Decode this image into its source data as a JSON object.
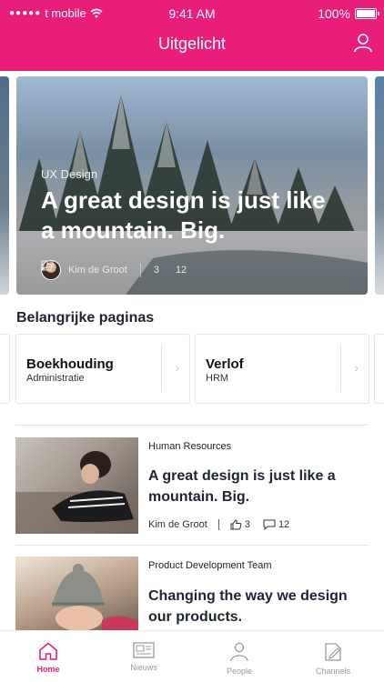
{
  "status_bar": {
    "carrier": "t mobile",
    "time": "9:41 AM",
    "battery": "100%"
  },
  "header": {
    "title": "Uitgelicht"
  },
  "hero": {
    "category": "UX Design",
    "title": "A great design is just like a mountain. Big.",
    "author": "Kim de Groot",
    "likes": "3",
    "comments": "12"
  },
  "important_pages": {
    "heading": "Belangrijke paginas",
    "items": [
      {
        "title": "Boekhouding",
        "subtitle": "Administratie"
      },
      {
        "title": "Verlof",
        "subtitle": "HRM"
      }
    ]
  },
  "news": [
    {
      "source": "Human Resources",
      "title": "A great design is just like a mountain. Big.",
      "author": "Kim de Groot",
      "likes": "3",
      "comments": "12"
    },
    {
      "source": "Product Development Team",
      "title": "Changing the way we design our products."
    }
  ],
  "tabs": [
    {
      "label": "Home",
      "icon": "home-icon",
      "active": true
    },
    {
      "label": "Nieuws",
      "icon": "news-icon",
      "active": false
    },
    {
      "label": "People",
      "icon": "people-icon",
      "active": false
    },
    {
      "label": "Channels",
      "icon": "channels-icon",
      "active": false
    }
  ],
  "colors": {
    "accent": "#e91e7a",
    "text_dark": "#1e2436"
  }
}
